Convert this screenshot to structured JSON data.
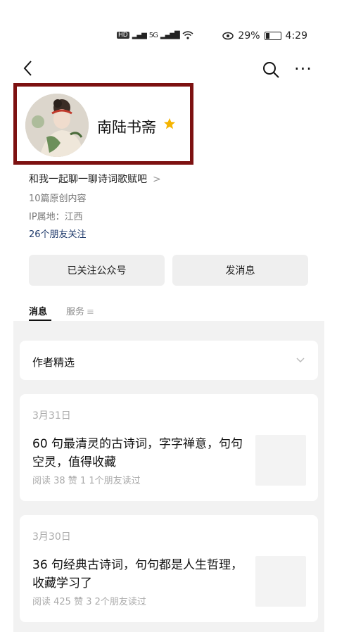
{
  "status_bar": {
    "left_badges": "HD",
    "signal_text": "5G",
    "battery": "29%",
    "battery_level": 0.29,
    "time": "4:29"
  },
  "profile": {
    "name": "南陆书斋",
    "intro": "和我一起聊一聊诗词歌赋吧",
    "articles": "10篇原创内容",
    "ip": "IP属地：江西",
    "friends": "26个朋友关注"
  },
  "buttons": {
    "follow": "已关注公众号",
    "message": "发消息"
  },
  "tabs": {
    "messages": "消息",
    "services": "服务"
  },
  "picks": {
    "title": "作者精选"
  },
  "articles": [
    {
      "date": "3月31日",
      "title": "60 句最清灵的古诗词，字字禅意，句句空灵，值得收藏",
      "stats": "阅读 38  赞 1  1个朋友读过"
    },
    {
      "date": "3月30日",
      "title": "36 句经典古诗词，句句都是人生哲理，收藏学习了",
      "stats": "阅读 425  赞 3  2个朋友读过"
    }
  ],
  "colors": {
    "highlight_border": "#7d1111",
    "star": "#f5b400",
    "link": "#1f3a6b"
  }
}
